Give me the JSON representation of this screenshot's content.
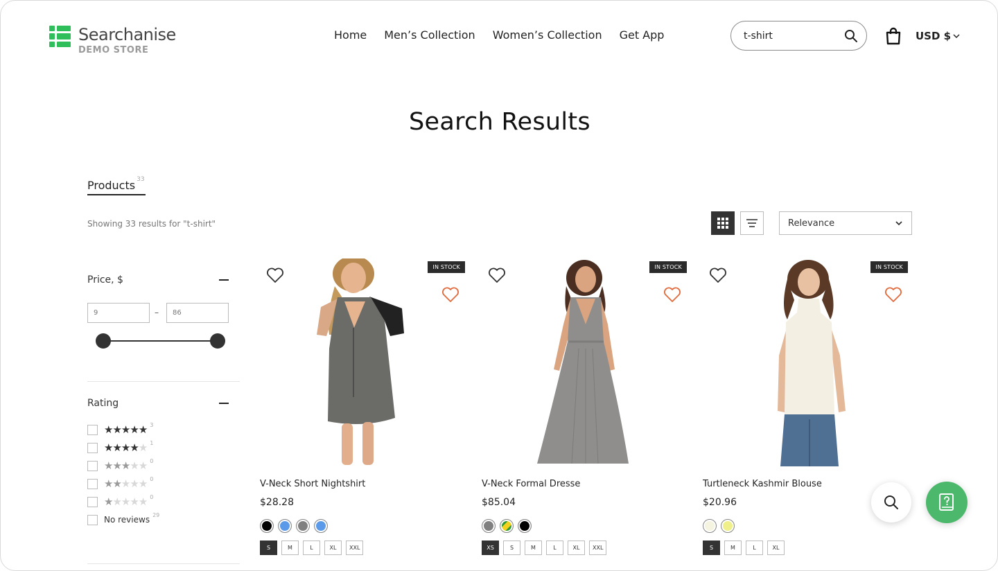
{
  "brand": {
    "name": "Searchanise",
    "subtitle": "DEMO STORE",
    "color": "#2fbf5a"
  },
  "nav": {
    "items": [
      {
        "label": "Home"
      },
      {
        "label": "Men’s Collection"
      },
      {
        "label": "Women’s Collection"
      },
      {
        "label": "Get App"
      }
    ]
  },
  "search": {
    "value": "t-shirt",
    "icon": "search-icon"
  },
  "header": {
    "cart_icon": "shopping-bag-icon",
    "currency": "USD $"
  },
  "page": {
    "title": "Search Results"
  },
  "tabs": {
    "products_label": "Products",
    "products_count": "33"
  },
  "results": {
    "summary": "Showing 33 results for \"t-shirt\""
  },
  "toolbar": {
    "sort_value": "Relevance",
    "grid_icon": "grid-view-icon",
    "list_icon": "list-view-icon"
  },
  "filters": {
    "price": {
      "title": "Price, $",
      "min": "9",
      "max": "86",
      "separator": "–"
    },
    "rating": {
      "title": "Rating",
      "rows": [
        {
          "stars": 5,
          "count": "3"
        },
        {
          "stars": 4,
          "count": "1"
        },
        {
          "stars": 3,
          "count": "0"
        },
        {
          "stars": 2,
          "count": "0"
        },
        {
          "stars": 1,
          "count": "0"
        }
      ],
      "no_reviews_label": "No reviews",
      "no_reviews_count": "29"
    }
  },
  "products": [
    {
      "name": "V-Neck Short Nightshirt",
      "price": "$28.28",
      "badge": "IN STOCK",
      "colors": [
        "#000000",
        "#5b9ae8",
        "#808080",
        "#5b9ae8"
      ],
      "sizes": [
        "S",
        "M",
        "L",
        "XL",
        "XXL"
      ],
      "selected_size": "S"
    },
    {
      "name": "V-Neck Formal Dresse",
      "price": "$85.04",
      "badge": "IN STOCK",
      "colors": [
        "#808080",
        "multicolor",
        "#000000"
      ],
      "sizes": [
        "XS",
        "S",
        "M",
        "L",
        "XL",
        "XXL"
      ],
      "selected_size": "XS"
    },
    {
      "name": "Turtleneck Kashmir Blouse",
      "price": "$20.96",
      "badge": "IN STOCK",
      "colors": [
        "#f4f4e0",
        "#f0f08a"
      ],
      "sizes": [
        "S",
        "M",
        "L",
        "XL"
      ],
      "selected_size": "S"
    }
  ],
  "widgets": {
    "search_fab_icon": "search-icon",
    "help_fab_icon": "help-book-icon",
    "help_color": "#4cb86b"
  }
}
